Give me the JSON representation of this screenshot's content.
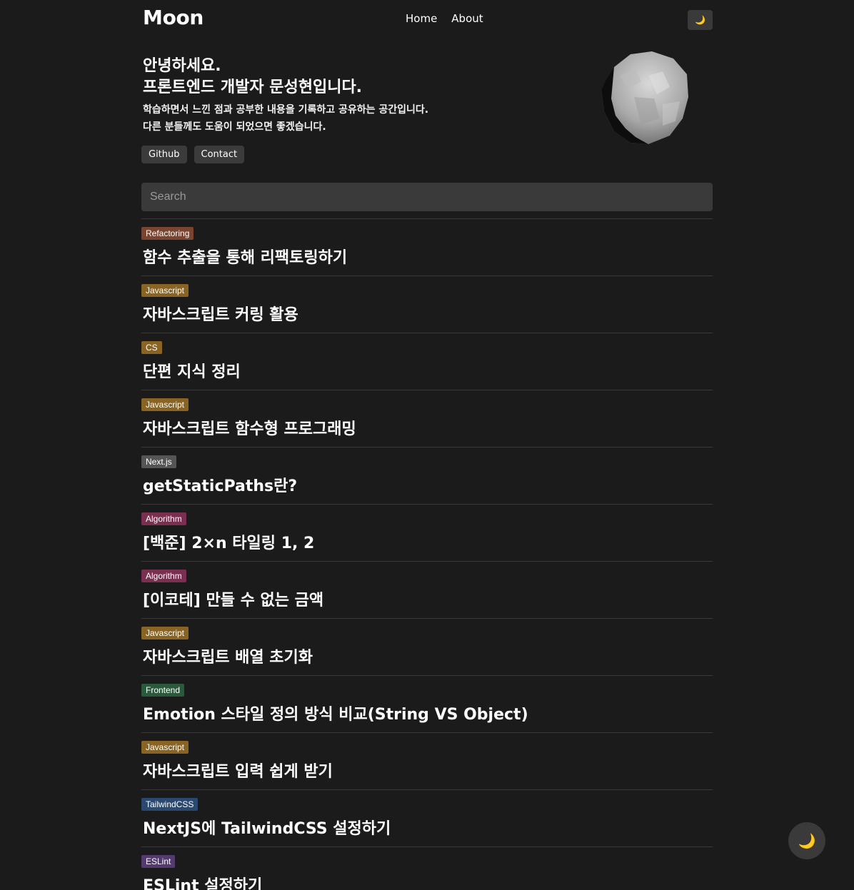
{
  "header": {
    "logo": "Moon",
    "nav": [
      "Home",
      "About"
    ],
    "theme_icon": "moon-icon"
  },
  "intro": {
    "greeting_line1": "안녕하세요.",
    "greeting_line2": "프론트엔드 개발자 문성현입니다.",
    "desc_line1": "학습하면서 느낀 점과 공부한 내용을 기록하고 공유하는 공간입니다.",
    "desc_line2": "다른 분들께도 도움이 되었으면 좋겠습니다.",
    "buttons": [
      "Github",
      "Contact"
    ]
  },
  "search": {
    "placeholder": "Search",
    "value": ""
  },
  "posts": [
    {
      "tag": "Refactoring",
      "color": "#7a4530",
      "title": "함수 추출을 통해 리팩토링하기"
    },
    {
      "tag": "Javascript",
      "color": "#8a6425",
      "title": "자바스크립트 커링 활용"
    },
    {
      "tag": "CS",
      "color": "#8a6425",
      "title": "단편 지식 정리"
    },
    {
      "tag": "Javascript",
      "color": "#8a6425",
      "title": "자바스크립트 함수형 프로그래밍"
    },
    {
      "tag": "Next.js",
      "color": "#555555",
      "title": "getStaticPaths란?"
    },
    {
      "tag": "Algorithm",
      "color": "#7a2f50",
      "title": "[백준] 2×n 타일링 1, 2"
    },
    {
      "tag": "Algorithm",
      "color": "#7a2f50",
      "title": "[이코테] 만들 수 없는 금액"
    },
    {
      "tag": "Javascript",
      "color": "#8a6425",
      "title": "자바스크립트 배열 초기화"
    },
    {
      "tag": "Frontend",
      "color": "#2a5a3c",
      "title": "Emotion 스타일 정의 방식 비교(String VS Object)"
    },
    {
      "tag": "Javascript",
      "color": "#8a6425",
      "title": "자바스크립트 입력 쉽게 받기"
    },
    {
      "tag": "TailwindCSS",
      "color": "#2a4870",
      "title": "NextJS에 TailwindCSS 설정하기"
    },
    {
      "tag": "ESLint",
      "color": "#553a70",
      "title": "ESLint 설정하기"
    }
  ],
  "floating_theme_icon": "moon-icon"
}
